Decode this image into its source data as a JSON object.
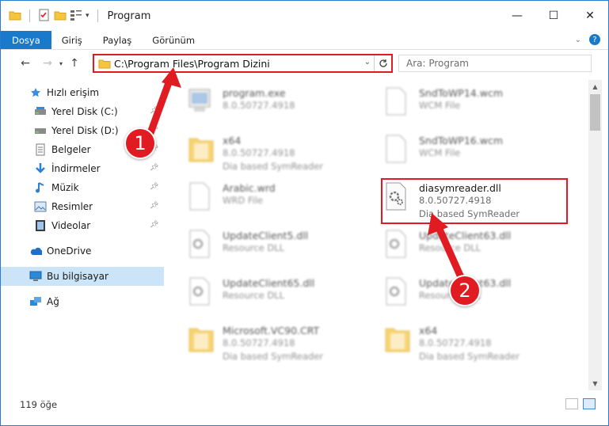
{
  "window": {
    "title": "Program",
    "controls": {
      "minimize": "—",
      "maximize": "☐",
      "close": "✕"
    }
  },
  "ribbon": {
    "tabs": [
      {
        "label": "Dosya"
      },
      {
        "label": "Giriş"
      },
      {
        "label": "Paylaş"
      },
      {
        "label": "Görünüm"
      }
    ],
    "help": "?"
  },
  "address": {
    "path": "C:\\Program Files\\Program Dizini",
    "search_placeholder": "Ara: Program"
  },
  "sidebar": {
    "items": [
      {
        "label": "Hızlı erişim",
        "icon": "star-icon"
      },
      {
        "label": "Yerel Disk (C:)",
        "icon": "drive-icon",
        "pinned": true
      },
      {
        "label": "Yerel Disk (D:)",
        "icon": "drive-icon",
        "pinned": true
      },
      {
        "label": "Belgeler",
        "icon": "documents-icon",
        "pinned": true
      },
      {
        "label": "İndirmeler",
        "icon": "download-icon",
        "pinned": true
      },
      {
        "label": "Müzik",
        "icon": "music-icon",
        "pinned": true
      },
      {
        "label": "Resimler",
        "icon": "pictures-icon",
        "pinned": true
      },
      {
        "label": "Videolar",
        "icon": "videos-icon",
        "pinned": true
      },
      {
        "label": "OneDrive",
        "icon": "cloud-icon"
      },
      {
        "label": "Bu bilgisayar",
        "icon": "computer-icon",
        "selected": true
      },
      {
        "label": "Ağ",
        "icon": "network-icon"
      }
    ]
  },
  "files": [
    {
      "name": "program.exe",
      "line1": "8.0.50727.4918",
      "line2": "",
      "type": "exe"
    },
    {
      "name": "SndToWP14.wcm",
      "line1": "WCM File",
      "line2": "",
      "type": "doc"
    },
    {
      "name": "x64",
      "line1": "8.0.50727.4918",
      "line2": "Dia based SymReader",
      "type": "folder"
    },
    {
      "name": "SndToWP16.wcm",
      "line1": "WCM File",
      "line2": "",
      "type": "doc"
    },
    {
      "name": "Arabic.wrd",
      "line1": "WRD File",
      "line2": "",
      "type": "doc"
    },
    {
      "name": "diasymreader.dll",
      "line1": "8.0.50727.4918",
      "line2": "Dia based SymReader",
      "type": "dll"
    },
    {
      "name": "UpdateClient5.dll",
      "line1": "Resource DLL",
      "line2": "",
      "type": "dll"
    },
    {
      "name": "UpdateClient63.dll",
      "line1": "Resource DLL",
      "line2": "",
      "type": "dll"
    },
    {
      "name": "UpdateClient65.dll",
      "line1": "Resource DLL",
      "line2": "",
      "type": "dll"
    },
    {
      "name": "UpdateClient63.dll",
      "line1": "Resource DLL",
      "line2": "",
      "type": "dll"
    },
    {
      "name": "Microsoft.VC90.CRT",
      "line1": "8.0.50727.4918",
      "line2": "Dia based SymReader",
      "type": "folder"
    },
    {
      "name": "x64",
      "line1": "8.0.50727.4918",
      "line2": "Dia based SymReader",
      "type": "folder"
    }
  ],
  "status": {
    "count": "119 öğe"
  },
  "annotations": {
    "step1": "1",
    "step2": "2",
    "color": "#e11b22"
  }
}
